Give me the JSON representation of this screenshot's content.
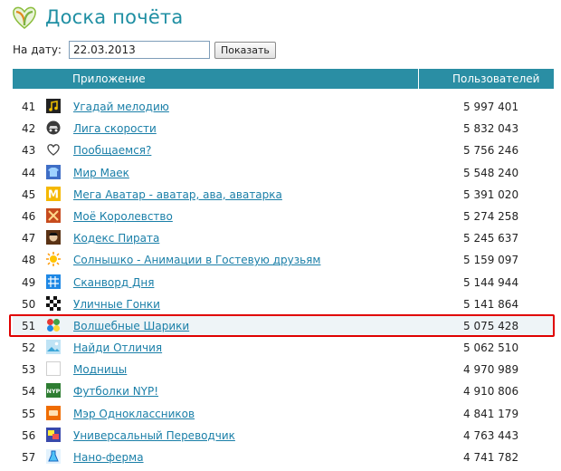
{
  "header": {
    "title": "Доска почёта"
  },
  "datebar": {
    "label": "На дату:",
    "date_value": "22.03.2013",
    "button_label": "Показать"
  },
  "table": {
    "col_app": "Приложение",
    "col_users": "Пользователей",
    "rows": [
      {
        "num": "41",
        "name": "Угадай мелодию",
        "users": "5 997 401",
        "icon": "music-note-icon"
      },
      {
        "num": "42",
        "name": "Лига скорости",
        "users": "5 832 043",
        "icon": "racing-car-icon"
      },
      {
        "num": "43",
        "name": "Пообщаемся?",
        "users": "5 756 246",
        "icon": "heart-icon"
      },
      {
        "num": "44",
        "name": "Мир Маек",
        "users": "5 548 240",
        "icon": "tshirt-icon"
      },
      {
        "num": "45",
        "name": "Мега Аватар - аватар, ава, аватарка",
        "users": "5 391 020",
        "icon": "letter-m-icon"
      },
      {
        "num": "46",
        "name": "Моё Королевство",
        "users": "5 274 258",
        "icon": "crossed-swords-icon"
      },
      {
        "num": "47",
        "name": "Кодекс Пирата",
        "users": "5 245 637",
        "icon": "pirate-icon"
      },
      {
        "num": "48",
        "name": "Солнышко - Анимации в Гостевую друзьям",
        "users": "5 159 097",
        "icon": "sun-icon"
      },
      {
        "num": "49",
        "name": "Сканворд Дня",
        "users": "5 144 944",
        "icon": "crossword-icon"
      },
      {
        "num": "50",
        "name": "Уличные Гонки",
        "users": "5 141 864",
        "icon": "checkered-flag-icon"
      },
      {
        "num": "51",
        "name": "Волшебные Шарики",
        "users": "5 075 428",
        "icon": "colored-balls-icon"
      },
      {
        "num": "52",
        "name": "Найди Отличия",
        "users": "5 062 510",
        "icon": "picture-icon"
      },
      {
        "num": "53",
        "name": "Модницы",
        "users": "4 970 989",
        "icon": "blank-icon"
      },
      {
        "num": "54",
        "name": "Футболки NYP!",
        "users": "4 910 806",
        "icon": "nyp-logo-icon"
      },
      {
        "num": "55",
        "name": "Мэр Одноклассников",
        "users": "4 841 179",
        "icon": "mayor-icon"
      },
      {
        "num": "56",
        "name": "Универсальный Переводчик",
        "users": "4 763 443",
        "icon": "translator-icon"
      },
      {
        "num": "57",
        "name": "Нано-ферма",
        "users": "4 741 782",
        "icon": "flask-icon"
      }
    ]
  }
}
